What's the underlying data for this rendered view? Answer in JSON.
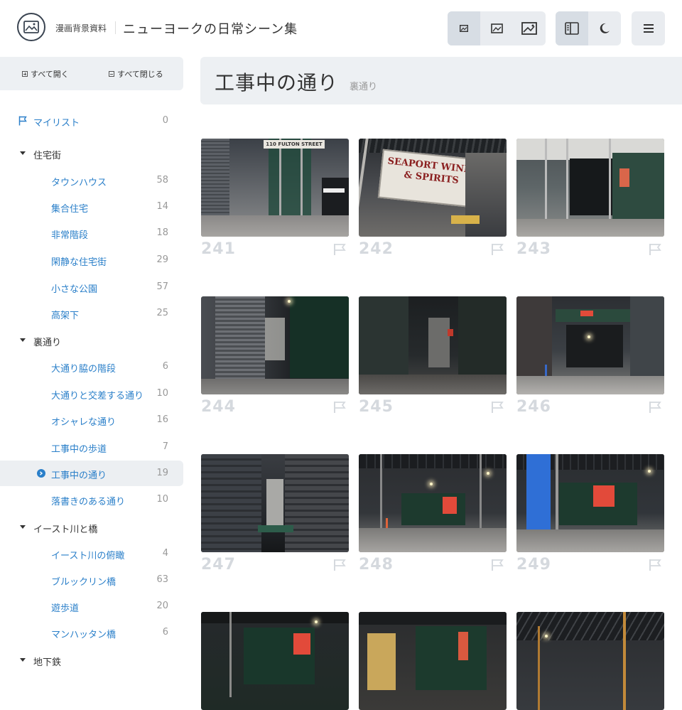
{
  "header": {
    "site_name": "漫画背景資料",
    "app_title": "ニューヨークの日常シーン集",
    "icons": [
      "logo-icon",
      "small-thumb-icon",
      "medium-thumb-icon",
      "large-thumb-icon",
      "sidebar-toggle-icon",
      "dark-mode-icon",
      "menu-icon"
    ]
  },
  "sidebar": {
    "expand_all": "すべて開く",
    "collapse_all": "すべて閉じる",
    "mylist": {
      "label": "マイリスト",
      "count": "0"
    },
    "sections": [
      {
        "label": "住宅街",
        "items": [
          {
            "label": "タウンハウス",
            "count": "58"
          },
          {
            "label": "集合住宅",
            "count": "14"
          },
          {
            "label": "非常階段",
            "count": "18"
          },
          {
            "label": "閑静な住宅街",
            "count": "29"
          },
          {
            "label": "小さな公園",
            "count": "57"
          },
          {
            "label": "高架下",
            "count": "25"
          }
        ]
      },
      {
        "label": "裏通り",
        "items": [
          {
            "label": "大通り脇の階段",
            "count": "6"
          },
          {
            "label": "大通りと交差する通り",
            "count": "10"
          },
          {
            "label": "オシャレな通り",
            "count": "16"
          },
          {
            "label": "工事中の歩道",
            "count": "7"
          },
          {
            "label": "工事中の通り",
            "count": "19"
          },
          {
            "label": "落書きのある通り",
            "count": "10"
          }
        ]
      },
      {
        "label": "イースト川と橋",
        "items": [
          {
            "label": "イースト川の俯瞰",
            "count": "4"
          },
          {
            "label": "ブルックリン橋",
            "count": "63"
          },
          {
            "label": "遊歩道",
            "count": "20"
          },
          {
            "label": "マンハッタン橋",
            "count": "6"
          }
        ]
      },
      {
        "label": "地下鉄",
        "items": []
      }
    ]
  },
  "main": {
    "title": "工事中の通り",
    "subtitle": "裏通り",
    "photos": [
      {
        "number": "241",
        "sign_text": "110 FULTON STREET"
      },
      {
        "number": "242",
        "sign_text": "SEAPORT WINES & SPIRITS"
      },
      {
        "number": "243"
      },
      {
        "number": "244"
      },
      {
        "number": "245"
      },
      {
        "number": "246"
      },
      {
        "number": "247"
      },
      {
        "number": "248"
      },
      {
        "number": "249"
      },
      {
        "number": ""
      },
      {
        "number": ""
      },
      {
        "number": ""
      }
    ]
  },
  "colors": {
    "accent": "#2a7fc9",
    "panel": "#edf0f3",
    "muted": "#999999",
    "number": "#d5d9de"
  }
}
